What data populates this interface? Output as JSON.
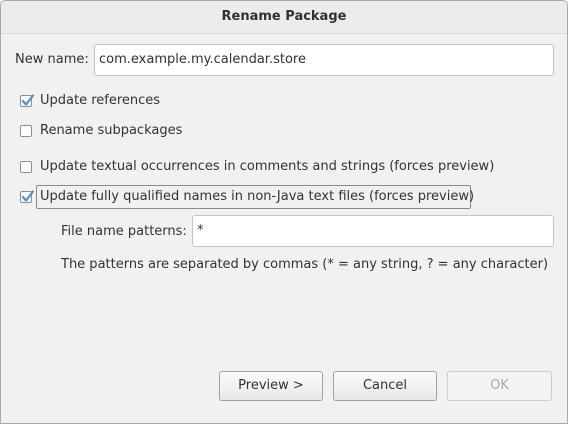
{
  "dialog": {
    "title": "Rename Package"
  },
  "form": {
    "new_name_label": "New name:",
    "new_name_value": "com.example.my.calendar.store",
    "update_references": {
      "label": "Update references",
      "checked": true
    },
    "rename_subpackages": {
      "label": "Rename subpackages",
      "checked": false
    },
    "update_textual": {
      "label": "Update textual occurrences in comments and strings (forces preview)",
      "checked": false
    },
    "update_qualified": {
      "label": "Update fully qualified names in non-Java text files (forces preview)",
      "checked": true
    },
    "file_patterns_label": "File name patterns:",
    "file_patterns_value": "*",
    "patterns_hint": "The patterns are separated by commas (* = any string, ? = any character)"
  },
  "buttons": {
    "preview": "Preview >",
    "cancel": "Cancel",
    "ok": "OK",
    "ok_enabled": false
  },
  "colors": {
    "checkmark": "#4a90d9",
    "window_bg": "#f2f1f0"
  }
}
